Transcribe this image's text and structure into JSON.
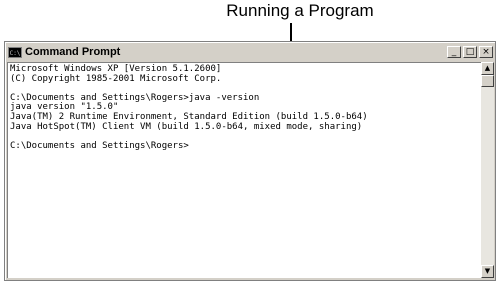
{
  "callout": {
    "text": "Running a Program"
  },
  "window": {
    "title": "Command Prompt",
    "icon_label": "C:\\",
    "controls": {
      "minimize": "_",
      "maximize": "□",
      "close": "×"
    }
  },
  "console": {
    "lines": [
      "Microsoft Windows XP [Version 5.1.2600]",
      "(C) Copyright 1985-2001 Microsoft Corp.",
      "",
      "C:\\Documents and Settings\\Rogers>java -version",
      "java version \"1.5.0\"",
      "Java(TM) 2 Runtime Environment, Standard Edition (build 1.5.0-b64)",
      "Java HotSpot(TM) Client VM (build 1.5.0-b64, mixed mode, sharing)",
      "",
      "C:\\Documents and Settings\\Rogers>"
    ]
  },
  "scrollbar": {
    "up_arrow": "▲",
    "down_arrow": "▼"
  }
}
